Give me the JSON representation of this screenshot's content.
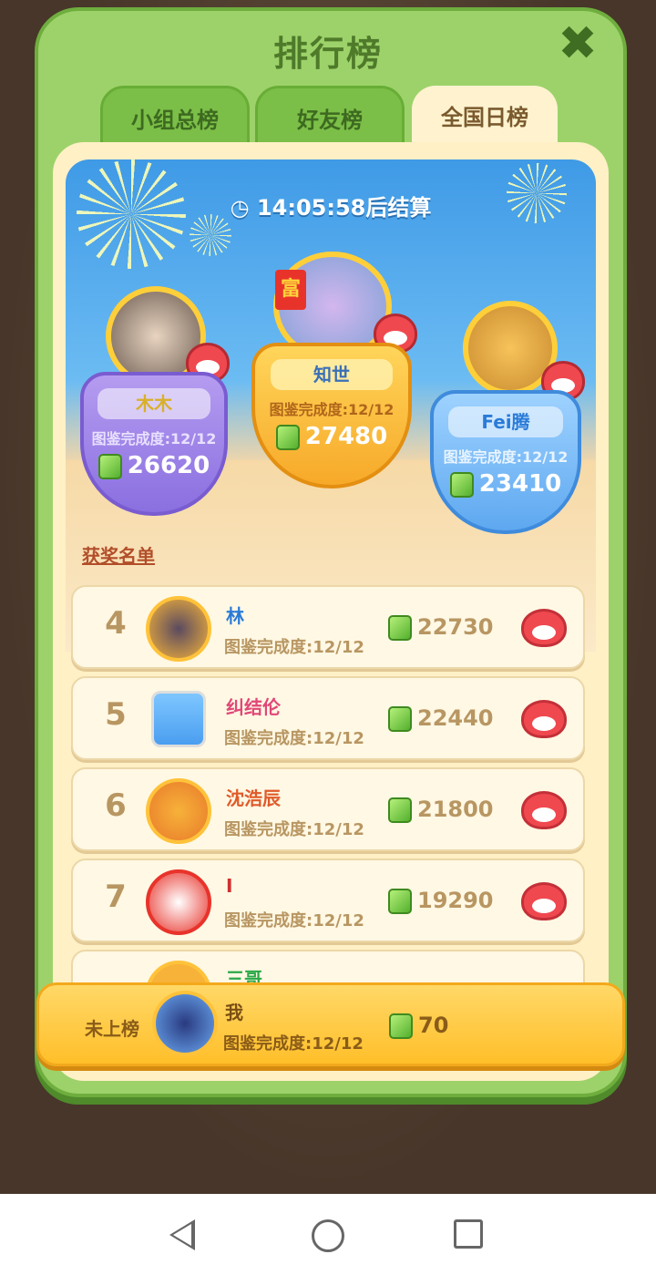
{
  "panel": {
    "title": "排行榜",
    "close_symbol": "✖"
  },
  "tabs": [
    {
      "label": "小组总榜",
      "active": false
    },
    {
      "label": "好友榜",
      "active": false
    },
    {
      "label": "全国日榜",
      "active": true
    }
  ],
  "timer": {
    "text": "14:05:58后结算",
    "icon": "clock-icon"
  },
  "podium": {
    "first": {
      "name": "知世",
      "completion": "图鉴完成度:12/12",
      "score": "27480",
      "badge_text": "富"
    },
    "second": {
      "name": "木木",
      "completion": "图鉴完成度:12/12",
      "score": "26620"
    },
    "third": {
      "name": "Fei腾",
      "completion": "图鉴完成度:12/12",
      "score": "23410"
    }
  },
  "winners_label": "获奖名单",
  "rankings": [
    {
      "rank": "4",
      "name": "林",
      "name_color": "#2a7bd8",
      "completion": "图鉴完成度:12/12",
      "score": "22730"
    },
    {
      "rank": "5",
      "name": "纠结伦",
      "name_color": "#e04878",
      "completion": "图鉴完成度:12/12",
      "score": "22440"
    },
    {
      "rank": "6",
      "name": "沈浩辰",
      "name_color": "#e05a2a",
      "completion": "图鉴完成度:12/12",
      "score": "21800"
    },
    {
      "rank": "7",
      "name": "I",
      "name_color": "#d03030",
      "completion": "图鉴完成度:12/12",
      "score": "19290"
    },
    {
      "rank": "",
      "name": "三哥",
      "name_color": "#2aa848",
      "completion": "",
      "score": ""
    }
  ],
  "self": {
    "rank_text": "未上榜",
    "name": "我",
    "completion": "图鉴完成度:12/12",
    "score": "70"
  },
  "colors": {
    "panel_green": "#9dd26a",
    "score_text": "#b89662",
    "self_bar": "#ffbf2a"
  }
}
